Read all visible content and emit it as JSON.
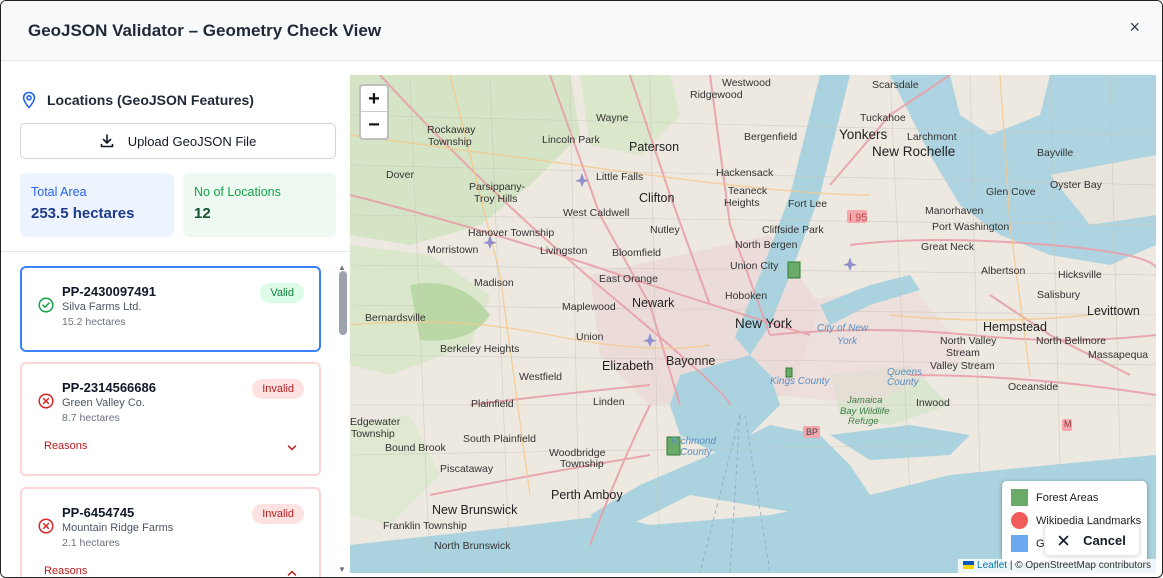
{
  "header": {
    "title": "GeoJSON Validator – Geometry Check View",
    "close_label": "×"
  },
  "sidebar": {
    "section_title": "Locations (GeoJSON Features)",
    "upload_label": "Upload GeoJSON File",
    "stats": {
      "total_area_label": "Total Area",
      "total_area_value": "253.5 hectares",
      "count_label": "No of Locations",
      "count_value": "12"
    },
    "locations": [
      {
        "id": "PP-2430097491",
        "owner": "Silva Farms Ltd.",
        "area": "15.2 hectares",
        "status": "Valid",
        "reasons_label": ""
      },
      {
        "id": "PP-2314566686",
        "owner": "Green Valley Co.",
        "area": "8.7 hectares",
        "status": "Invalid",
        "reasons_label": "Reasons"
      },
      {
        "id": "PP-6454745",
        "owner": "Mountain Ridge Farms",
        "area": "2.1 hectares",
        "status": "Invalid",
        "reasons_label": "Reasons"
      }
    ]
  },
  "map": {
    "zoom_in": "+",
    "zoom_out": "−",
    "legend": [
      {
        "label": "Forest Areas",
        "color": "#6aab6a"
      },
      {
        "label": "Wikipedia Landmarks",
        "color": "#f05a5a"
      },
      {
        "label": "G",
        "color": "#6aa8ef"
      }
    ],
    "cancel_label": "Cancel",
    "attribution_leaflet": "Leaflet",
    "attribution_rest": "| © OpenStreetMap contributors",
    "places": {
      "westwood": "Westwood",
      "ridgewood": "Ridgewood",
      "yonkers": "Yonkers",
      "scarsdale": "Scarsdale",
      "rockaway": "Rockaway",
      "township1": "Township",
      "wayne": "Wayne",
      "lincoln_park": "Lincoln Park",
      "paterson": "Paterson",
      "bergenfield": "Bergenfield",
      "tuckahoe": "Tuckahoe",
      "larchmont": "Larchmont",
      "new_rochelle": "New Rochelle",
      "bayville": "Bayville",
      "dover": "Dover",
      "little_falls": "Little Falls",
      "hackensack": "Hackensack",
      "parsippany": "Parsippany-",
      "troy_hills": "Troy Hills",
      "clifton": "Clifton",
      "teaneck": "Teaneck",
      "glen_cove": "Glen Cove",
      "oyster_bay": "Oyster Bay",
      "west_caldwell": "West Caldwell",
      "heights": "Heights",
      "fort_lee": "Fort Lee",
      "i95": "I 95",
      "manorhaven": "Manorhaven",
      "hanover": "Hanover Township",
      "nutley": "Nutley",
      "cliffside": "Cliffside Park",
      "port_washington": "Port Washington",
      "morristown": "Morristown",
      "livingston": "Livingston",
      "bloomfield": "Bloomfield",
      "north_bergen": "North Bergen",
      "great_neck": "Great Neck",
      "union_city": "Union City",
      "hicksville": "Hicksville",
      "east_orange": "East Orange",
      "albertson": "Albertson",
      "madison": "Madison",
      "newark": "Newark",
      "hoboken": "Hoboken",
      "salisbury": "Salisbury",
      "bernardsville": "Bernardsville",
      "maplewood": "Maplewood",
      "new_york": "New York",
      "hempstead": "Hempstead",
      "levittown": "Levittown",
      "city_of_ny": "City of New",
      "york": "York",
      "union": "Union",
      "north_valley": "North Valley",
      "stream": "Stream",
      "north_bellmore": "North Bellmore",
      "berkeley": "Berkeley Heights",
      "elizabeth": "Elizabeth",
      "bayonne": "Bayonne",
      "valley_stream": "Valley Stream",
      "massapequa": "Massapequa",
      "westfield": "Westfield",
      "kings_county": "Kings County",
      "queens_county": "Queens",
      "county": "County",
      "oceanside": "Oceanside",
      "plainfield": "Plainfield",
      "linden": "Linden",
      "jamaica": "Jamaica",
      "bay_wildlife": "Bay Wildlife",
      "refuge": "Refuge",
      "inwood": "Inwood",
      "edgewater": "Edgewater",
      "township2": "Township",
      "south_plainfield": "South Plainfield",
      "bp": "BP",
      "bound_brook": "Bound Brook",
      "woodbridge": "Woodbridge",
      "township3": "Township",
      "piscataway": "Piscataway",
      "perth_amboy": "Perth Amboy",
      "new_brunswick": "New Brunswick",
      "franklin": "Franklin Township",
      "north_brunswick": "North Brunswick",
      "richmond": "Richmond",
      "richmond_county": "County",
      "m": "M"
    }
  }
}
